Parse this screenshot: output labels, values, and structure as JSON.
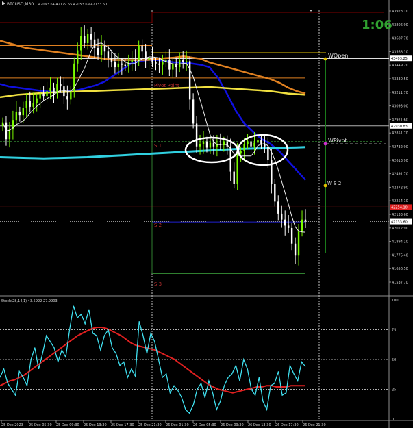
{
  "window": {
    "title": "BTCUSD,M30",
    "ohlc_text": "42093.64 42179.55 42053.69 42133.60",
    "countdown": "1:06"
  },
  "colors": {
    "bull_candle": "#7CFC00",
    "bear_candle": "#FFFFFF",
    "stoch_main": "#40E0F0",
    "stoch_signal": "#E02020",
    "ma_blue": "#1010E0",
    "ma_yellow": "#F0E040",
    "ma_orange": "#E08020",
    "ma_cyan": "#30D0E0",
    "price_line": "#FF2020"
  },
  "price_axis": {
    "ticks": [
      "43928.10",
      "43806.90",
      "43687.70",
      "43568.10",
      "43449.20",
      "43330.50",
      "43211.70",
      "43093.00",
      "42971.60",
      "42851.70",
      "42732.90",
      "42613.90",
      "42491.70",
      "42372.90",
      "42254.10",
      "42133.60",
      "42012.90",
      "41894.10",
      "41775.40",
      "41656.50",
      "41537.70"
    ],
    "boxes": [
      {
        "label": "43493.25",
        "value": 43493.25,
        "color": "#FFFFFF",
        "text": "#000000"
      },
      {
        "label": "42930.83",
        "value": 42930.83,
        "color": "#FFFFFF",
        "text": "#000000"
      },
      {
        "label": "42254.10",
        "value": 42254.1,
        "color": "#E02020",
        "text": "#FFFFFF"
      },
      {
        "label": "42133.60",
        "value": 42133.6,
        "color": "#FFFFFF",
        "text": "#000000"
      }
    ]
  },
  "levels": {
    "pivot_point": "Pivot Point",
    "s1": "S 1",
    "s2": "S 2",
    "s3": "S 3",
    "wopen": "WOpen",
    "wpivot": "WPivot",
    "ws2": "W S 2"
  },
  "stoch": {
    "label": "Stoch(28,14,1) 43.5922 27.9903",
    "ticks": [
      "100",
      "75",
      "50",
      "25",
      "0"
    ]
  },
  "time_axis": [
    "25 Dec 2023",
    "25 Dec 05:30",
    "25 Dec 09:30",
    "25 Dec 13:30",
    "25 Dec 17:30",
    "25 Dec 21:30",
    "26 Dec 01:30",
    "26 Dec 05:30",
    "26 Dec 09:30",
    "26 Dec 13:30",
    "26 Dec 17:30",
    "26 Dec 21:30"
  ],
  "chart_data": {
    "type": "candlestick",
    "symbol": "BTCUSD",
    "timeframe": "M30",
    "ylim": [
      41537.7,
      43928.1
    ],
    "closes": [
      42960,
      42820,
      42900,
      42980,
      43050,
      43020,
      43080,
      43140,
      43090,
      43120,
      43160,
      43200,
      43180,
      43220,
      43250,
      43200,
      43280,
      43260,
      43180,
      43150,
      43220,
      43450,
      43560,
      43680,
      43620,
      43700,
      43650,
      43580,
      43520,
      43600,
      43550,
      43500,
      43460,
      43420,
      43450,
      43440,
      43430,
      43460,
      43480,
      43470,
      43600,
      43550,
      43480,
      43500,
      43460,
      43450,
      43440,
      43460,
      43480,
      43400,
      43450,
      43420,
      43480,
      43460,
      43470,
      43150,
      42950,
      42760,
      42780,
      42800,
      42750,
      42790,
      42760,
      42780,
      42770,
      42800,
      42760,
      42550,
      42450,
      42700,
      42720,
      42780,
      42800,
      42760,
      42790,
      42810,
      42780,
      42760,
      42650,
      42450,
      42300,
      42200,
      42150,
      42100,
      42080,
      41950,
      41850,
      42050,
      42150,
      42133.6
    ],
    "moving_averages": [
      {
        "color": "blue",
        "values": [
          43280,
          43260,
          43250,
          43240,
          43230,
          43220,
          43215,
          43210,
          43220,
          43230,
          43250,
          43270,
          43300,
          43350,
          43400,
          43450,
          43470,
          43480,
          43480,
          43470,
          43460,
          43460,
          43450,
          43440,
          43420,
          43330,
          43200,
          43060,
          42950,
          42880,
          42820,
          42780,
          42720,
          42640,
          42560,
          42480
        ]
      },
      {
        "color": "yellow",
        "values": [
          43170,
          43180,
          43190,
          43195,
          43200,
          43205,
          43210,
          43212,
          43215,
          43218,
          43220,
          43222,
          43225,
          43228,
          43230,
          43232,
          43235,
          43238,
          43240,
          43242,
          43245,
          43248,
          43250,
          43252,
          43255,
          43250,
          43245,
          43240,
          43235,
          43230,
          43225,
          43220,
          43210,
          43200,
          43195,
          43190
        ]
      },
      {
        "color": "orange",
        "values": [
          43640,
          43620,
          43600,
          43580,
          43570,
          43560,
          43550,
          43540,
          43530,
          43520,
          43510,
          43500,
          43490,
          43480,
          43480,
          43480,
          43480,
          43480,
          43490,
          43495,
          43500,
          43510,
          43500,
          43490,
          43460,
          43440,
          43420,
          43400,
          43380,
          43360,
          43340,
          43320,
          43290,
          43250,
          43220,
          43200
        ]
      },
      {
        "color": "cyan",
        "values": [
          42670,
          42668,
          42666,
          42664,
          42662,
          42660,
          42662,
          42664,
          42666,
          42668,
          42670,
          42674,
          42678,
          42682,
          42686,
          42690,
          42694,
          42698,
          42702,
          42706,
          42710,
          42714,
          42718,
          42722,
          42726,
          42730,
          42734,
          42738,
          42740,
          42742,
          42744,
          42746,
          42748,
          42750,
          42752,
          42754
        ]
      }
    ],
    "pivot_levels": {
      "Pivot Point": 43330,
      "S 1": 42800,
      "S 2": 42130,
      "S 3": 41700,
      "WOpen": 43540,
      "WPivot": 42790,
      "W S 2": 42440
    },
    "stochastic": {
      "params": "28,14,1",
      "ylim": [
        0,
        100
      ],
      "main": [
        35,
        42,
        30,
        25,
        20,
        40,
        35,
        28,
        50,
        60,
        42,
        55,
        70,
        65,
        60,
        48,
        58,
        52,
        75,
        95,
        85,
        88,
        80,
        92,
        72,
        70,
        58,
        70,
        75,
        60,
        55,
        45,
        48,
        35,
        42,
        36,
        82,
        70,
        55,
        72,
        65,
        50,
        35,
        38,
        22,
        28,
        24,
        18,
        8,
        5,
        12,
        25,
        30,
        18,
        32,
        22,
        8,
        15,
        28,
        35,
        38,
        45,
        32,
        50,
        42,
        25,
        20,
        35,
        15,
        8,
        28,
        30,
        40,
        20,
        22,
        45,
        38,
        32,
        48,
        44
      ],
      "signal": [
        28,
        30,
        32,
        33,
        35,
        37,
        40,
        43,
        46,
        49,
        52,
        55,
        58,
        61,
        64,
        67,
        70,
        72,
        74,
        76,
        77,
        77,
        76,
        74,
        72,
        70,
        67,
        64,
        62,
        61,
        60,
        59,
        58,
        56,
        54,
        52,
        50,
        47,
        44,
        41,
        38,
        35,
        32,
        29,
        27,
        25,
        24,
        23,
        22,
        23,
        24,
        25,
        26,
        27,
        27,
        28,
        28,
        27,
        27,
        27,
        28,
        28,
        28,
        28
      ]
    }
  }
}
